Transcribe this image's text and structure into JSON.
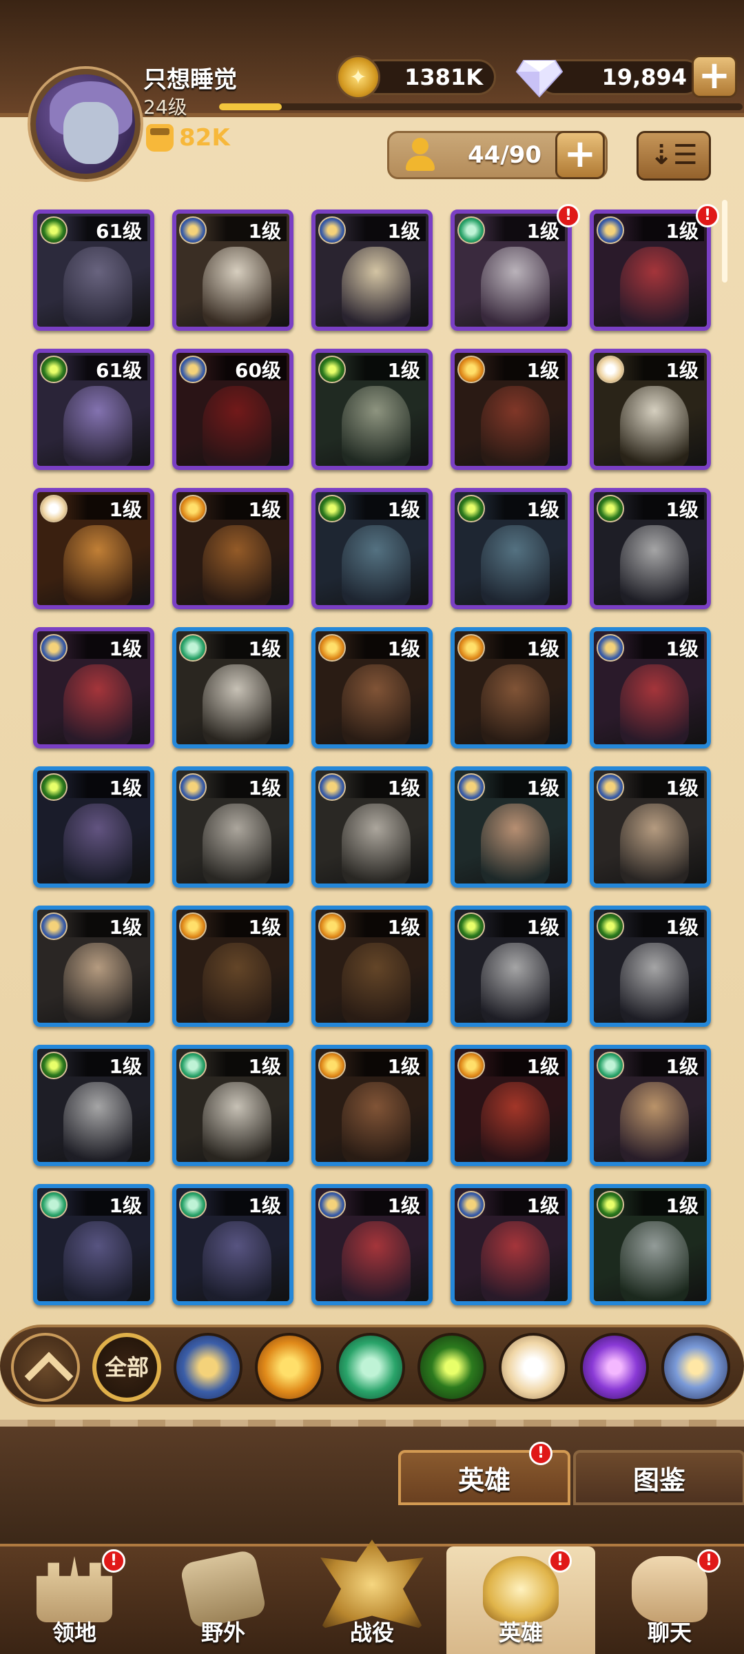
{
  "player": {
    "name": "只想睡觉",
    "level": "24级",
    "power": "82K",
    "exp_progress": 0.12
  },
  "currency": {
    "gold": "1381K",
    "diamonds": "19,894"
  },
  "heroes_header": {
    "count": "44/90",
    "add": "+",
    "sort": "⇣☰"
  },
  "heroes": [
    {
      "level": "61级",
      "frame": "purple",
      "faction": "graveborn",
      "alert": false
    },
    {
      "level": "1级",
      "frame": "purple",
      "faction": "lightbearer",
      "alert": false
    },
    {
      "level": "1级",
      "frame": "purple",
      "faction": "lightbearer",
      "alert": false
    },
    {
      "level": "1级",
      "frame": "purple",
      "faction": "wilder",
      "alert": true
    },
    {
      "level": "1级",
      "frame": "purple",
      "faction": "lightbearer",
      "alert": true
    },
    {
      "level": "61级",
      "frame": "purple",
      "faction": "graveborn",
      "alert": false
    },
    {
      "level": "60级",
      "frame": "purple",
      "faction": "lightbearer",
      "alert": false
    },
    {
      "level": "1级",
      "frame": "purple",
      "faction": "graveborn",
      "alert": false
    },
    {
      "level": "1级",
      "frame": "purple",
      "faction": "mauler",
      "alert": false
    },
    {
      "level": "1级",
      "frame": "purple",
      "faction": "celestial",
      "alert": false
    },
    {
      "level": "1级",
      "frame": "purple",
      "faction": "celestial",
      "alert": false
    },
    {
      "level": "1级",
      "frame": "purple",
      "faction": "mauler",
      "alert": false
    },
    {
      "level": "1级",
      "frame": "purple",
      "faction": "graveborn",
      "alert": false
    },
    {
      "level": "1级",
      "frame": "purple",
      "faction": "graveborn",
      "alert": false
    },
    {
      "level": "1级",
      "frame": "purple",
      "faction": "graveborn",
      "alert": false
    },
    {
      "level": "1级",
      "frame": "purple",
      "faction": "lightbearer",
      "alert": false
    },
    {
      "level": "1级",
      "frame": "blue",
      "faction": "wilder",
      "alert": false
    },
    {
      "level": "1级",
      "frame": "blue",
      "faction": "mauler",
      "alert": false
    },
    {
      "level": "1级",
      "frame": "blue",
      "faction": "mauler",
      "alert": false
    },
    {
      "level": "1级",
      "frame": "blue",
      "faction": "lightbearer",
      "alert": false
    },
    {
      "level": "1级",
      "frame": "blue",
      "faction": "graveborn",
      "alert": false
    },
    {
      "level": "1级",
      "frame": "blue",
      "faction": "lightbearer",
      "alert": false
    },
    {
      "level": "1级",
      "frame": "blue",
      "faction": "lightbearer",
      "alert": false
    },
    {
      "level": "1级",
      "frame": "blue",
      "faction": "lightbearer",
      "alert": false
    },
    {
      "level": "1级",
      "frame": "blue",
      "faction": "lightbearer",
      "alert": false
    },
    {
      "level": "1级",
      "frame": "blue",
      "faction": "lightbearer",
      "alert": false
    },
    {
      "level": "1级",
      "frame": "blue",
      "faction": "mauler",
      "alert": false
    },
    {
      "level": "1级",
      "frame": "blue",
      "faction": "mauler",
      "alert": false
    },
    {
      "level": "1级",
      "frame": "blue",
      "faction": "graveborn",
      "alert": false
    },
    {
      "level": "1级",
      "frame": "blue",
      "faction": "graveborn",
      "alert": false
    },
    {
      "level": "1级",
      "frame": "blue",
      "faction": "graveborn",
      "alert": false
    },
    {
      "level": "1级",
      "frame": "blue",
      "faction": "wilder",
      "alert": false
    },
    {
      "level": "1级",
      "frame": "blue",
      "faction": "mauler",
      "alert": false
    },
    {
      "level": "1级",
      "frame": "blue",
      "faction": "mauler",
      "alert": false
    },
    {
      "level": "1级",
      "frame": "blue",
      "faction": "wilder",
      "alert": false
    },
    {
      "level": "1级",
      "frame": "blue",
      "faction": "wilder",
      "alert": false
    },
    {
      "level": "1级",
      "frame": "blue",
      "faction": "wilder",
      "alert": false
    },
    {
      "level": "1级",
      "frame": "blue",
      "faction": "lightbearer",
      "alert": false
    },
    {
      "level": "1级",
      "frame": "blue",
      "faction": "lightbearer",
      "alert": false
    },
    {
      "level": "1级",
      "frame": "blue",
      "faction": "graveborn",
      "alert": false
    }
  ],
  "faction_filters": {
    "all_label": "全部",
    "items": [
      "up",
      "lightbearer",
      "mauler",
      "wilder",
      "graveborn",
      "celestial",
      "hypogean",
      "dimensional"
    ]
  },
  "tabs": {
    "heroes": "英雄",
    "codex": "图鉴"
  },
  "bottom_nav": [
    {
      "label": "领地",
      "icon": "castle-icon",
      "alert": true,
      "active": false
    },
    {
      "label": "野外",
      "icon": "scroll-map-icon",
      "alert": false,
      "active": false
    },
    {
      "label": "战役",
      "icon": "battle-emblem-icon",
      "alert": false,
      "active": false
    },
    {
      "label": "英雄",
      "icon": "hero-helmet-icon",
      "alert": true,
      "active": true
    },
    {
      "label": "聊天",
      "icon": "chat-icon",
      "alert": true,
      "active": false
    }
  ],
  "colors": {
    "purple_frame": "#7a3fc4",
    "blue_frame": "#2487d9",
    "alert": "#e01818",
    "parchment": "#f0dcb4"
  }
}
